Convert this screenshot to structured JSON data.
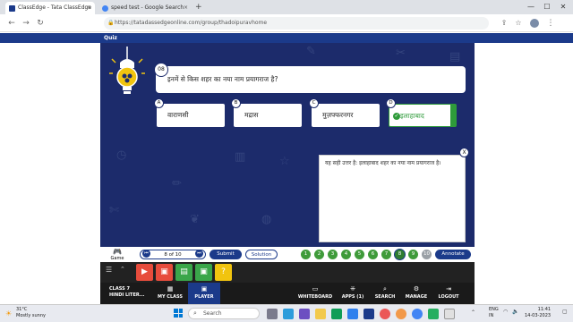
{
  "browser": {
    "tabs": [
      {
        "title": "ClassEdge - Tata ClassEdge",
        "fav_color": "#1b3a8a"
      },
      {
        "title": "speed test - Google Search",
        "fav_color": "#4285f4"
      }
    ],
    "new_tab_symbol": "+",
    "close_symbol": "×",
    "window": {
      "minimize": "—",
      "maximize": "☐",
      "close": "✕"
    },
    "url": "https://tatadassedgeonline.com/group/thadoipuravhome"
  },
  "header": {
    "title": "Quiz"
  },
  "quiz": {
    "question_number": "08",
    "question_text": "इनमें से किस शहर का नया नाम प्रयागराज है?",
    "options": [
      {
        "letter": "A",
        "text": "वाराणसी",
        "correct": false
      },
      {
        "letter": "B",
        "text": "मद्रास",
        "correct": false
      },
      {
        "letter": "C",
        "text": "मुज़फ्फरनगर",
        "correct": false
      },
      {
        "letter": "D",
        "text": "इलाहाबाद",
        "correct": true
      }
    ],
    "solution_text": "यह सही उत्तर है: इलाहाबाद शहर का नया नाम प्रयागराज है।",
    "solution_close": "X"
  },
  "controls": {
    "game_label": "Game",
    "page_indicator": "8 of 10",
    "submit_label": "Submit",
    "solution_label": "Solution",
    "question_dots": [
      "1",
      "2",
      "3",
      "4",
      "5",
      "6",
      "7",
      "8",
      "9",
      "10"
    ],
    "annotate_label": "Annotate"
  },
  "toolbar": {
    "tool_buttons": [
      {
        "icon": "video-icon",
        "color": "#e74c3c"
      },
      {
        "icon": "gallery-icon",
        "color": "#e74c3c"
      },
      {
        "icon": "doc-icon",
        "color": "#3aa64a"
      },
      {
        "icon": "gallery-icon",
        "color": "#3aa64a"
      },
      {
        "icon": "quiz-icon",
        "color": "#f1c40f"
      }
    ]
  },
  "bottomnav": {
    "class_label": "CLASS 7",
    "subject_label": "HINDI LITER...",
    "items": [
      {
        "label": "MY CLASS",
        "icon": "myclass-icon"
      },
      {
        "label": "PLAYER",
        "icon": "player-icon"
      },
      {
        "label": "WHITEBOARD",
        "icon": "whiteboard-icon"
      },
      {
        "label": "APPS (1)",
        "icon": "apps-icon"
      },
      {
        "label": "SEARCH",
        "icon": "search-icon"
      },
      {
        "label": "MANAGE",
        "icon": "manage-icon"
      },
      {
        "label": "LOGOUT",
        "icon": "logout-icon"
      }
    ]
  },
  "taskbar": {
    "weather_temp": "31°C",
    "weather_desc": "Mostly sunny",
    "search_placeholder": "Search",
    "lang": "ENG",
    "region": "IN",
    "time": "11:41",
    "date": "14-03-2023"
  }
}
